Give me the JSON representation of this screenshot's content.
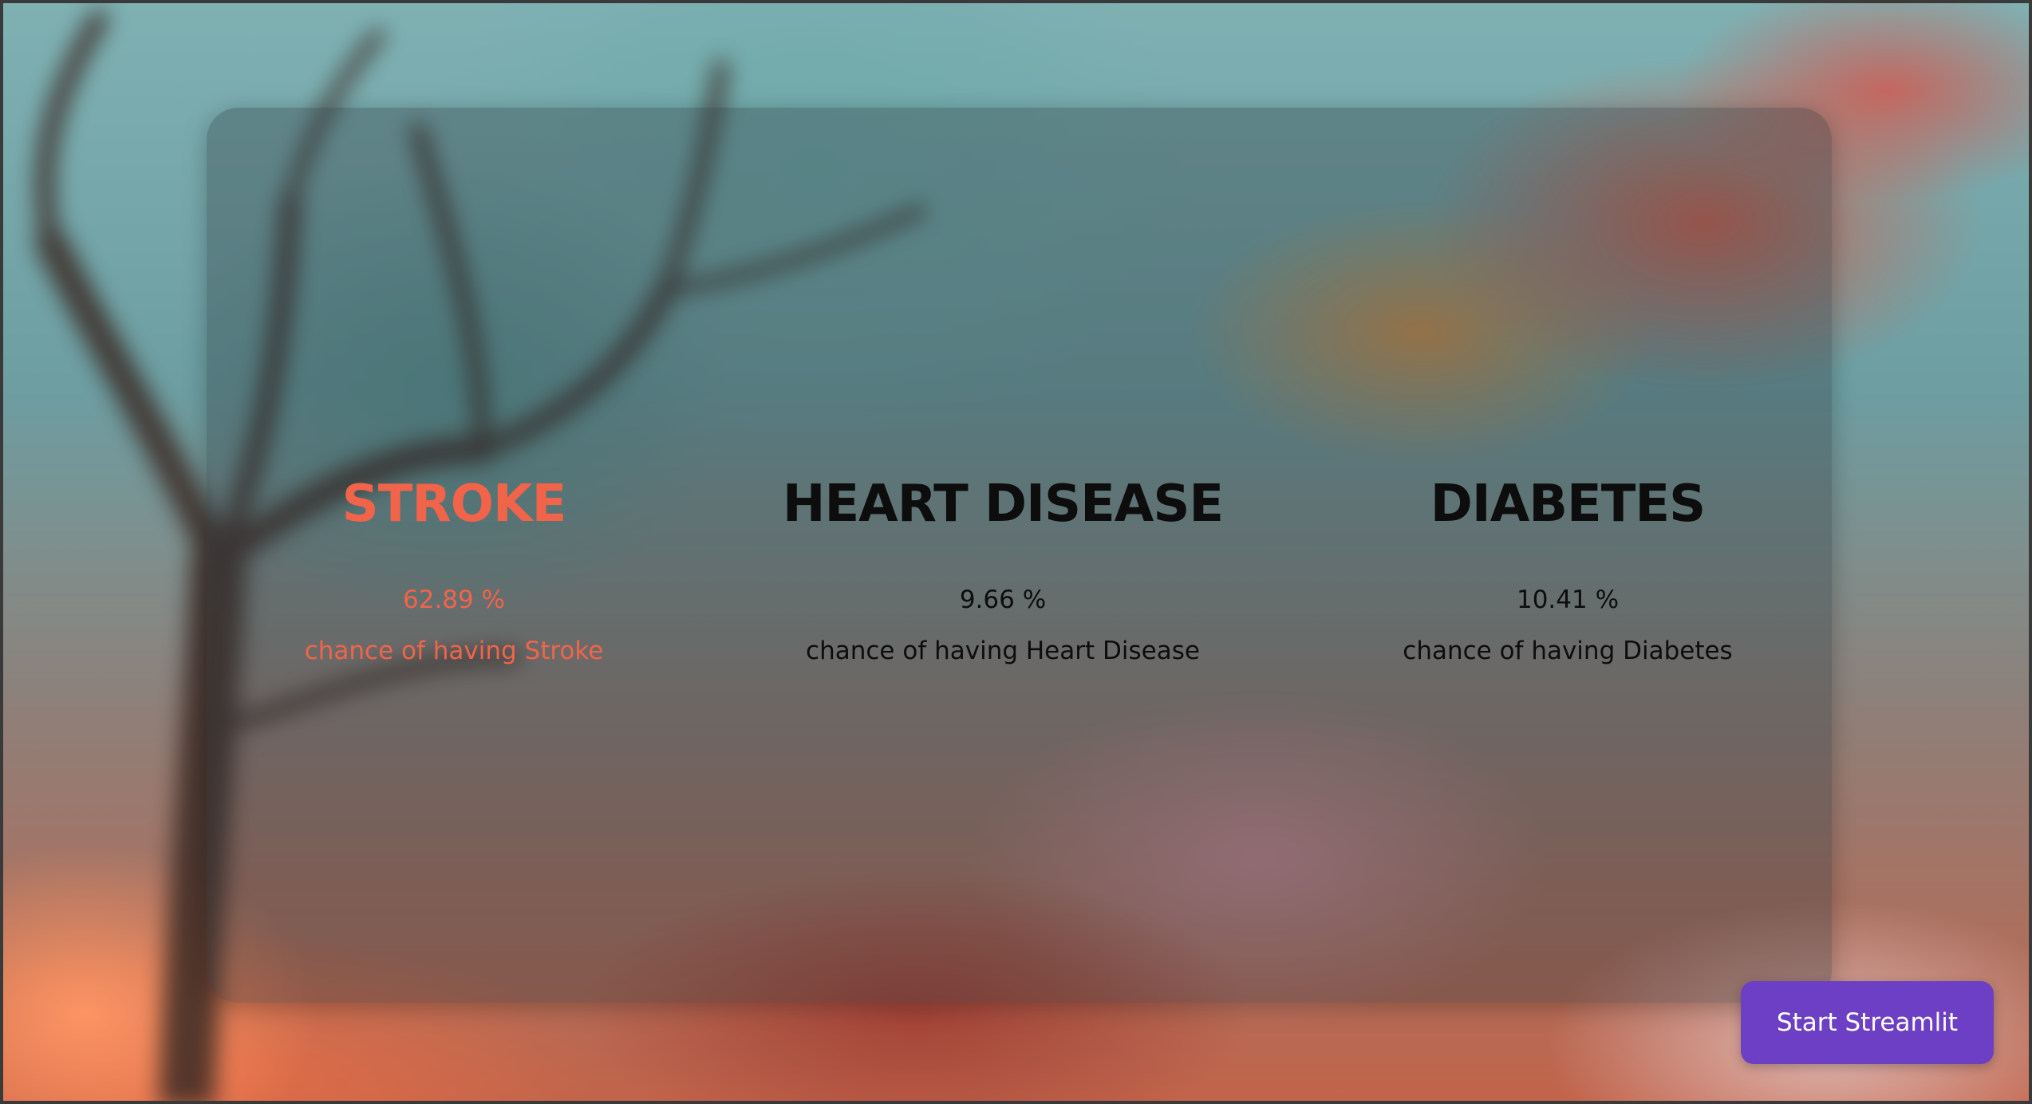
{
  "colors": {
    "highlight": "#f2644a",
    "default_text": "#0d0d0d",
    "button_bg": "#6d3fc4",
    "button_text": "#ffffff"
  },
  "results": [
    {
      "title": "STROKE",
      "percentage": "62.89 %",
      "description": "chance of having Stroke",
      "highlighted": true
    },
    {
      "title": "HEART DISEASE",
      "percentage": "9.66 %",
      "description": "chance of having Heart Disease",
      "highlighted": false
    },
    {
      "title": "DIABETES",
      "percentage": "10.41 %",
      "description": "chance of having Diabetes",
      "highlighted": false
    }
  ],
  "start_button": {
    "label": "Start Streamlit"
  }
}
